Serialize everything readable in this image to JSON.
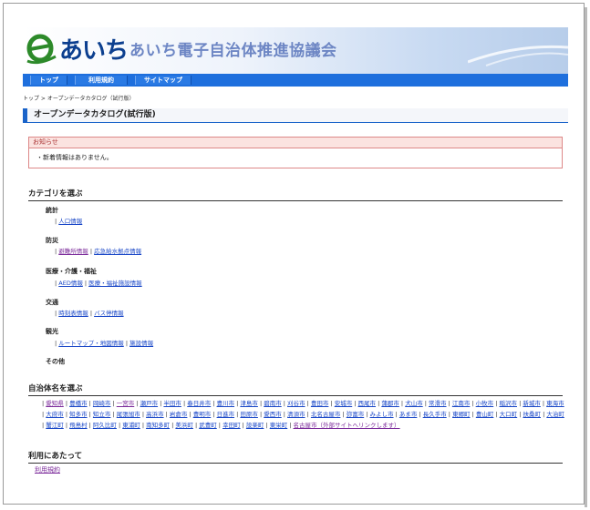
{
  "header": {
    "logo_text": "あいち",
    "site_name": "あいち電子自治体推進協議会"
  },
  "nav": {
    "items": [
      "トップ",
      "利用規約",
      "サイトマップ"
    ]
  },
  "breadcrumb": "トップ > オープンデータカタログ（試行版）",
  "page_title": "オープンデータカタログ(試行版)",
  "notice": {
    "title": "お知らせ",
    "body": "・新着情報はありません。"
  },
  "category_section": {
    "heading": "カテゴリを選ぶ",
    "categories": [
      {
        "name": "統計",
        "links": [
          "人口情報"
        ]
      },
      {
        "name": "防災",
        "links": [
          "避難所情報",
          "応急給水拠点情報"
        ]
      },
      {
        "name": "医療・介護・福祉",
        "links": [
          "AED情報",
          "医療・福祉施設情報"
        ]
      },
      {
        "name": "交通",
        "links": [
          "時刻表情報",
          "バス停情報"
        ]
      },
      {
        "name": "観光",
        "links": [
          "ルートマップ・地図情報",
          "施設情報"
        ]
      },
      {
        "name": "その他",
        "links": []
      }
    ]
  },
  "municipality_section": {
    "heading": "自治体名を選ぶ",
    "names": [
      "愛知県",
      "豊橋市",
      "岡崎市",
      "一宮市",
      "瀬戸市",
      "半田市",
      "春日井市",
      "豊川市",
      "津島市",
      "碧南市",
      "刈谷市",
      "豊田市",
      "安城市",
      "西尾市",
      "蒲郡市",
      "犬山市",
      "常滑市",
      "江南市",
      "小牧市",
      "稲沢市",
      "新城市",
      "東海市",
      "大府市",
      "知多市",
      "知立市",
      "尾張旭市",
      "高浜市",
      "岩倉市",
      "豊明市",
      "日進市",
      "田原市",
      "愛西市",
      "清須市",
      "北名古屋市",
      "弥富市",
      "みよし市",
      "あま市",
      "長久手市",
      "東郷町",
      "豊山町",
      "大口町",
      "扶桑町",
      "大治町",
      "蟹江町",
      "飛島村",
      "阿久比町",
      "東浦町",
      "南知多町",
      "美浜町",
      "武豊町",
      "幸田町",
      "設楽町",
      "東栄町",
      "名古屋市（外部サイトへリンクします）"
    ]
  },
  "usage_section": {
    "heading": "利用にあたって",
    "link": "利用規約"
  }
}
